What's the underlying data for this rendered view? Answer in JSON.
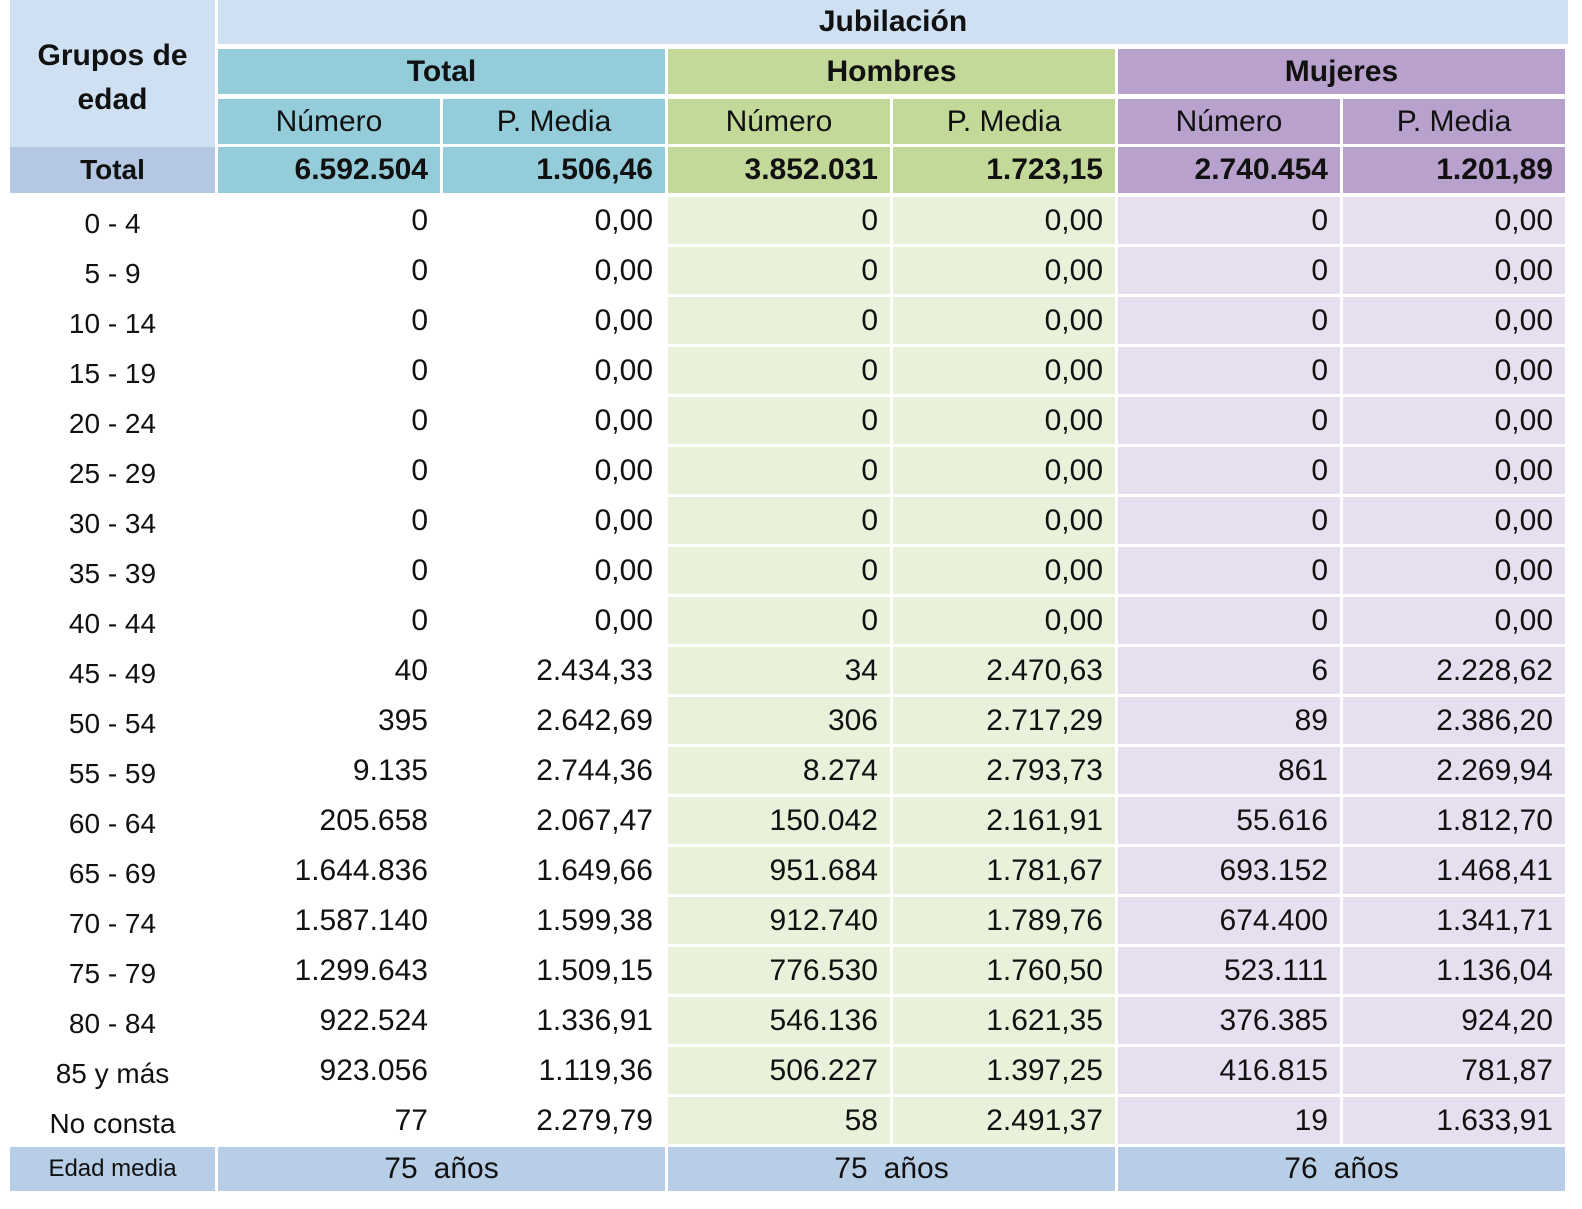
{
  "header": {
    "age_label": "Grupos de edad",
    "jubilacion": "Jubilación",
    "groups": [
      "Total",
      "Hombres",
      "Mujeres"
    ],
    "numero": "Número",
    "pmedia": "P. Media"
  },
  "total_row": {
    "label": "Total",
    "values": [
      "6.592.504",
      "1.506,46",
      "3.852.031",
      "1.723,15",
      "2.740.454",
      "1.201,89"
    ]
  },
  "rows": [
    {
      "age": "0 - 4",
      "values": [
        "0",
        "0,00",
        "0",
        "0,00",
        "0",
        "0,00"
      ]
    },
    {
      "age": "5 - 9",
      "values": [
        "0",
        "0,00",
        "0",
        "0,00",
        "0",
        "0,00"
      ]
    },
    {
      "age": "10 - 14",
      "values": [
        "0",
        "0,00",
        "0",
        "0,00",
        "0",
        "0,00"
      ]
    },
    {
      "age": "15 - 19",
      "values": [
        "0",
        "0,00",
        "0",
        "0,00",
        "0",
        "0,00"
      ]
    },
    {
      "age": "20 - 24",
      "values": [
        "0",
        "0,00",
        "0",
        "0,00",
        "0",
        "0,00"
      ]
    },
    {
      "age": "25 - 29",
      "values": [
        "0",
        "0,00",
        "0",
        "0,00",
        "0",
        "0,00"
      ]
    },
    {
      "age": "30 - 34",
      "values": [
        "0",
        "0,00",
        "0",
        "0,00",
        "0",
        "0,00"
      ]
    },
    {
      "age": "35 - 39",
      "values": [
        "0",
        "0,00",
        "0",
        "0,00",
        "0",
        "0,00"
      ]
    },
    {
      "age": "40 - 44",
      "values": [
        "0",
        "0,00",
        "0",
        "0,00",
        "0",
        "0,00"
      ]
    },
    {
      "age": "45 - 49",
      "values": [
        "40",
        "2.434,33",
        "34",
        "2.470,63",
        "6",
        "2.228,62"
      ]
    },
    {
      "age": "50 - 54",
      "values": [
        "395",
        "2.642,69",
        "306",
        "2.717,29",
        "89",
        "2.386,20"
      ]
    },
    {
      "age": "55 - 59",
      "values": [
        "9.135",
        "2.744,36",
        "8.274",
        "2.793,73",
        "861",
        "2.269,94"
      ]
    },
    {
      "age": "60 - 64",
      "values": [
        "205.658",
        "2.067,47",
        "150.042",
        "2.161,91",
        "55.616",
        "1.812,70"
      ]
    },
    {
      "age": "65 - 69",
      "values": [
        "1.644.836",
        "1.649,66",
        "951.684",
        "1.781,67",
        "693.152",
        "1.468,41"
      ]
    },
    {
      "age": "70 - 74",
      "values": [
        "1.587.140",
        "1.599,38",
        "912.740",
        "1.789,76",
        "674.400",
        "1.341,71"
      ]
    },
    {
      "age": "75 - 79",
      "values": [
        "1.299.643",
        "1.509,15",
        "776.530",
        "1.760,50",
        "523.111",
        "1.136,04"
      ]
    },
    {
      "age": "80 - 84",
      "values": [
        "922.524",
        "1.336,91",
        "546.136",
        "1.621,35",
        "376.385",
        "924,20"
      ]
    },
    {
      "age": "85 y más",
      "values": [
        "923.056",
        "1.119,36",
        "506.227",
        "1.397,25",
        "416.815",
        "781,87"
      ]
    },
    {
      "age": "No consta",
      "values": [
        "77",
        "2.279,79",
        "58",
        "2.491,37",
        "19",
        "1.633,91"
      ]
    }
  ],
  "avg_row": {
    "label": "Edad media",
    "values": [
      "75",
      "75",
      "76"
    ],
    "unit": "años"
  },
  "colors": {
    "total_header": "#94ccda",
    "hombres_header": "#c2d99a",
    "mujeres_header": "#b9a1cd",
    "hombres_cell": "#e9f1db",
    "mujeres_cell": "#e5dfef",
    "header_bg": "#cfe0f3"
  }
}
